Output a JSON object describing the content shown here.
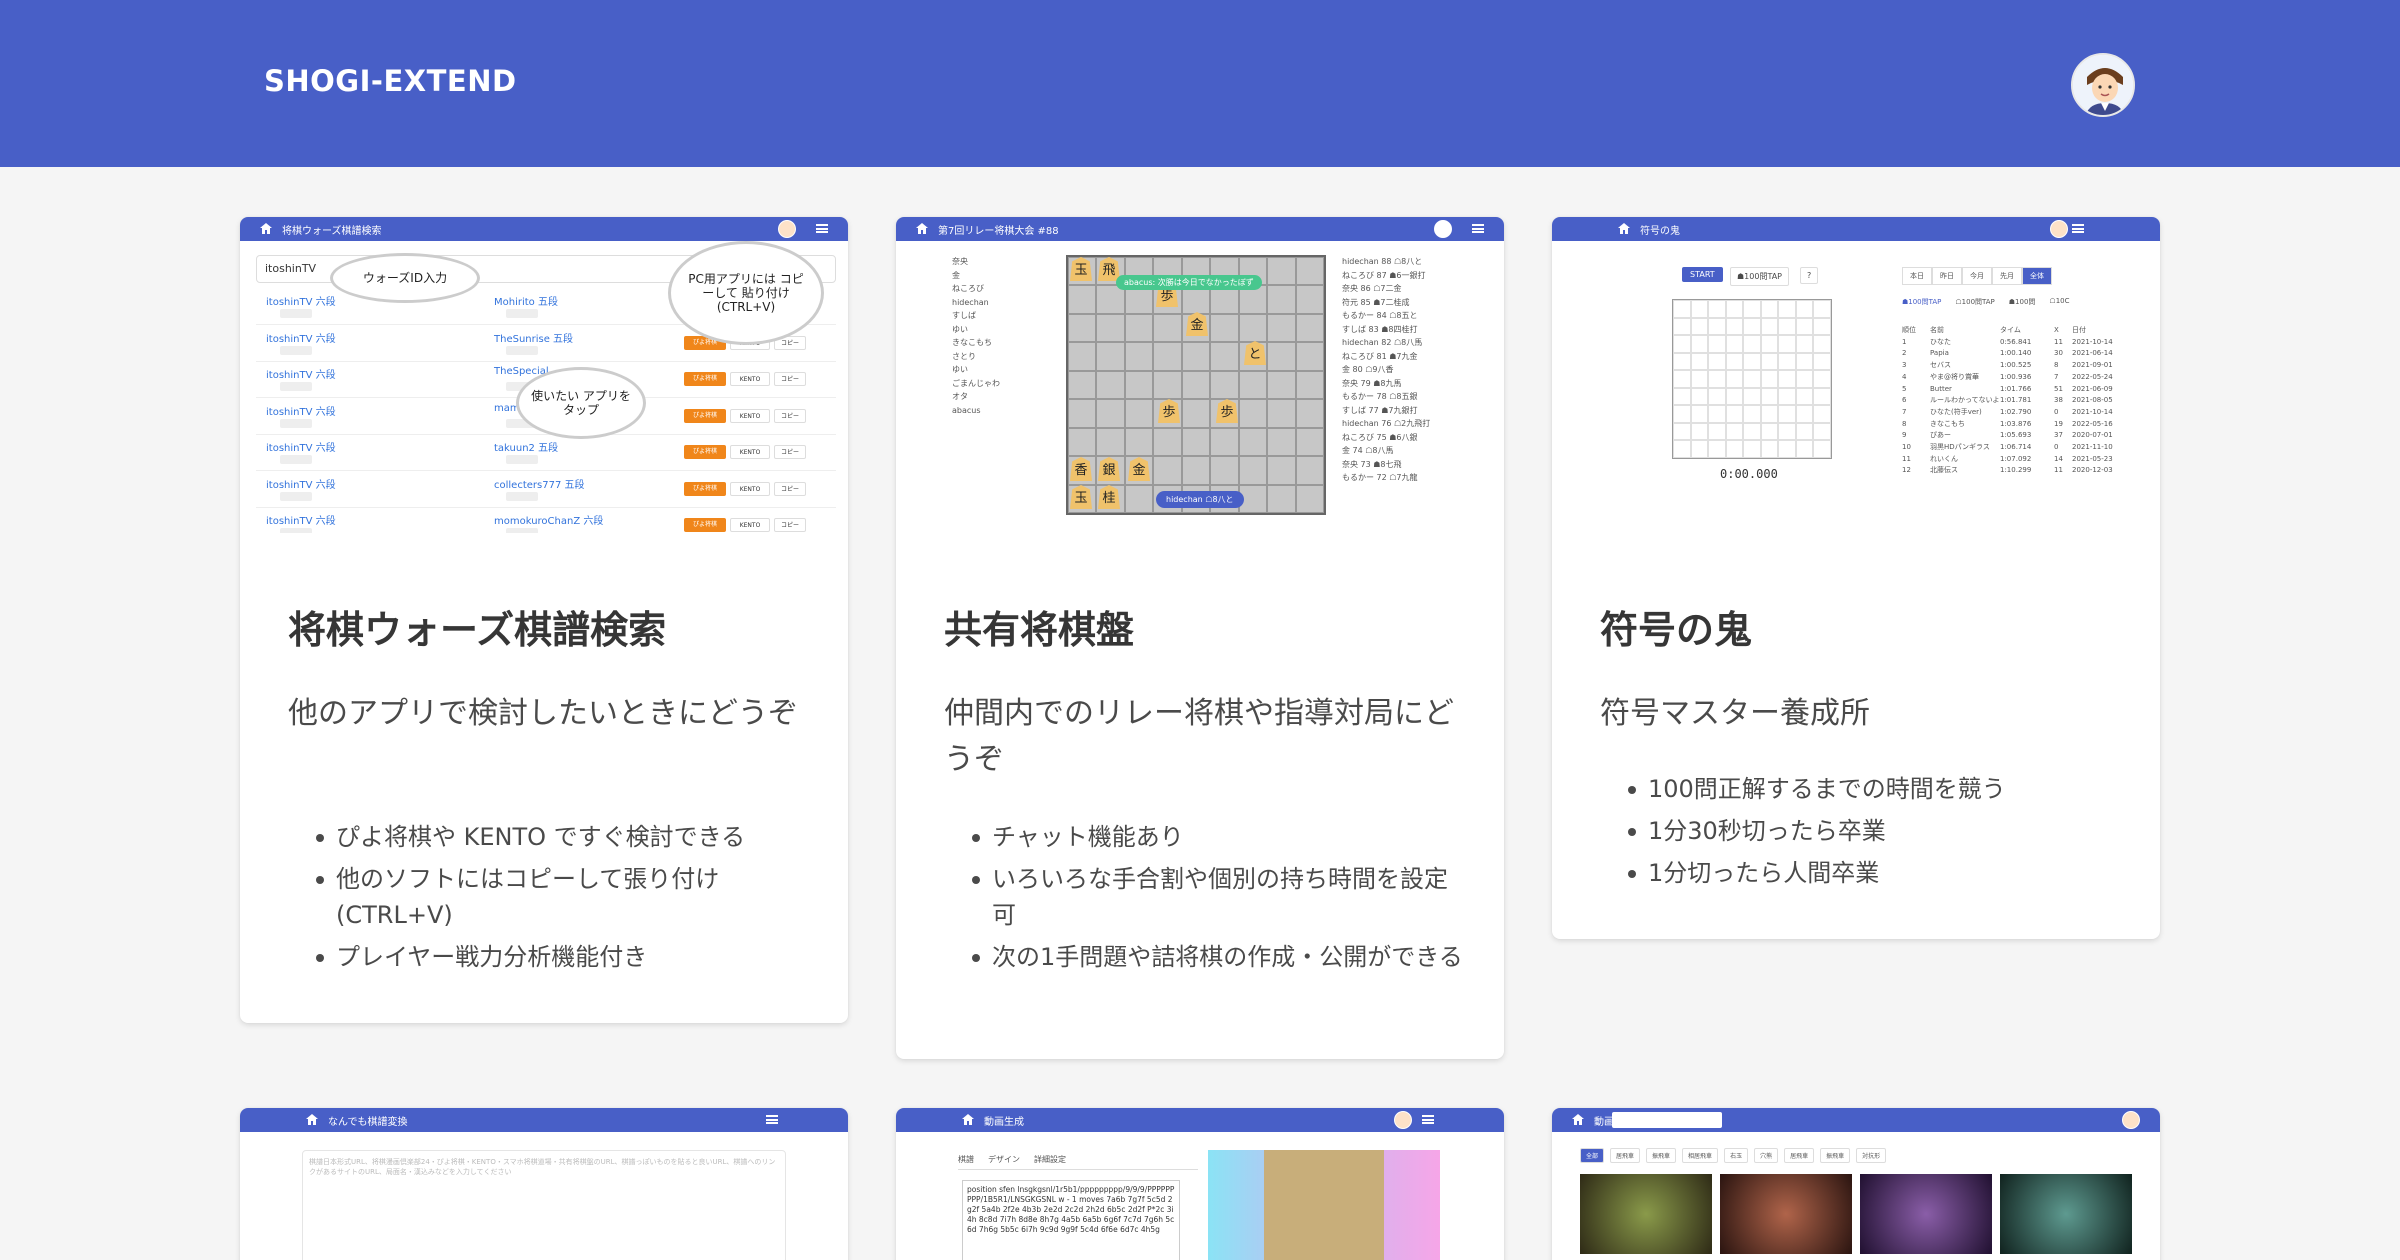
{
  "header": {
    "brand": "SHOGI-EXTEND"
  },
  "cards": [
    {
      "title": "将棋ウォーズ棋譜検索",
      "subtitle": "他のアプリで検討したいときにどうぞ",
      "features": [
        "ぴよ将棋や KENTO ですぐ検討できる",
        "他のソフトにはコピーして張り付け (CTRL+V)",
        "プレイヤー戦力分析機能付き"
      ],
      "thumb": {
        "nav_title": "将棋ウォーズ棋譜検索",
        "search_value": "itoshinTV",
        "bubble_id": "ウォーズID入力",
        "bubble_pc": "PC用アプリには コピーして 貼り付け(CTRL+V)",
        "bubble_tap": "使いたい アプリをタップ",
        "rows": [
          {
            "left": "itoshinTV 六段",
            "right": "Mohirito 五段"
          },
          {
            "left": "itoshinTV 六段",
            "right": "TheSunrise 五段"
          },
          {
            "left": "itoshinTV 六段",
            "right": "TheSpecial"
          },
          {
            "left": "itoshinTV 六段",
            "right": "mam"
          },
          {
            "left": "itoshinTV 六段",
            "right": "takuun2 五段"
          },
          {
            "left": "itoshinTV 六段",
            "right": "collecters777 五段"
          },
          {
            "left": "itoshinTV 六段",
            "right": "momokuroChanZ 六段"
          }
        ],
        "btn_piyo": "ぴよ将棋",
        "btn_kento": "KENTO",
        "btn_copy": "コピー"
      }
    },
    {
      "title": "共有将棋盤",
      "subtitle": "仲間内でのリレー将棋や指導対局にどうぞ",
      "features": [
        "チャット機能あり",
        "いろいろな手合割や個別の持ち時間を設定可",
        "次の1手問題や詰将棋の作成・公開ができる"
      ],
      "thumb": {
        "nav_title": "第7回リレー将棋大会 #88",
        "left_players": [
          "奈央",
          "金",
          "ねころび",
          "hidechan",
          "すしば",
          "ゆい",
          "きなこもち",
          "さとり",
          "ゆい",
          "ごまんじゃわ",
          "オタ",
          "abacus"
        ],
        "right_players": [
          "hidechan 88 ☖8八と",
          "ねころび 87 ☗6一銀打",
          "奈央 86 ☖7二金",
          "符元 85 ☗7二桂成",
          "もるかー 84 ☖8五と",
          "すしば 83 ☗8四桂打",
          "hidechan 82 ☖8八馬",
          "ねころび 81 ☗7九金",
          "金 80 ☖9八香",
          "奈央 79 ☗8九馬",
          "もるかー 78 ☖8五銀",
          "すしば 77 ☗7九銀打",
          "hidechan 76 ☖2九飛打",
          "ねころび 75 ☗6八銀",
          "金 74 ☖8八馬",
          "奈央 73 ☗8七飛",
          "もるかー 72 ☖7九龍"
        ],
        "chat": "abacus: 次勝は今日でなかったぼず",
        "turn": "hidechan ☖8八と"
      }
    },
    {
      "title": "符号の鬼",
      "subtitle": "符号マスター養成所",
      "features": [
        "100問正解するまでの時間を競う",
        "1分30秒切ったら卒業",
        "1分切ったら人間卒業"
      ],
      "thumb": {
        "nav_title": "符号の鬼",
        "start": "START",
        "mode": "☗100問TAP",
        "help": "?",
        "timer": "0:00.000",
        "periods": [
          "本日",
          "昨日",
          "今月",
          "先月",
          "全体"
        ],
        "rules": [
          "☗100問TAP",
          "☖100問TAP",
          "☗100問",
          "☖10C"
        ],
        "table_headers": [
          "順位",
          "名前",
          "タイム",
          "X",
          "日付"
        ],
        "ranks": [
          [
            "1",
            "ひなた",
            "0:56.841",
            "11",
            "2021-10-14"
          ],
          [
            "2",
            "Papia",
            "1:00.140",
            "30",
            "2021-06-14"
          ],
          [
            "3",
            "セバス",
            "1:00.525",
            "8",
            "2021-09-01"
          ],
          [
            "4",
            "やま@将り賞華",
            "1:00.936",
            "7",
            "2022-05-24"
          ],
          [
            "5",
            "Butter",
            "1:01.766",
            "51",
            "2021-06-09"
          ],
          [
            "6",
            "ルールわかってないよ",
            "1:01.781",
            "38",
            "2021-08-05"
          ],
          [
            "7",
            "ひなた(符手ver)",
            "1:02.790",
            "0",
            "2021-10-14"
          ],
          [
            "8",
            "きなこもち",
            "1:03.876",
            "19",
            "2022-05-16"
          ],
          [
            "9",
            "ぴあー",
            "1:05.693",
            "37",
            "2020-07-01"
          ],
          [
            "10",
            "羽黒HDパンギラス",
            "1:06.714",
            "0",
            "2021-11-10"
          ],
          [
            "11",
            "れいくん",
            "1:07.092",
            "14",
            "2021-05-23"
          ],
          [
            "12",
            "北藤伝ス",
            "1:10.299",
            "11",
            "2020-12-03"
          ]
        ]
      }
    },
    {
      "thumb": {
        "nav_title": "なんでも棋譜変換",
        "placeholder": "棋譜日本形式URL、将棋漫画倶楽部24・ぴよ将棋・KENTO・スマホ将棋道場・共有将棋盤のURL、棋譜っぽいものを貼ると良いURL、棋譜へのリンクがあるサイトのURL、局面名・漢込みなどを入力してください"
      }
    },
    {
      "thumb": {
        "nav_title": "動画生成",
        "tabs": [
          "棋譜",
          "デザイン",
          "詳細設定"
        ],
        "kifu_text": "position sfen lnsgkgsnl/1r5b1/ppppppppp/9/9/9/PPPPPPPPP/1B5R1/LNSGKGSNL w - 1 moves 7a6b 7g7f 5c5d 2g2f 5a4b 2f2e 4b3b 2e2d 2c2d 2h2d 6b5c 2d2f P*2c 3i4h 8c8d 7i7h 8d8e 8h7g 4a5b 6a5b 6g6f 7c7d 7g6h 5c6d 7h6g 5b5c 6i7h 9c9d 9g9f 5c4d 6f6e 6d7c 4h5g"
      }
    },
    {
      "thumb": {
        "nav_title": "動画",
        "filters": [
          "全部",
          "居飛車",
          "振飛車",
          "相居飛車",
          "右玉",
          "穴熊",
          "居飛車",
          "振飛車",
          "対抗形"
        ]
      }
    }
  ]
}
